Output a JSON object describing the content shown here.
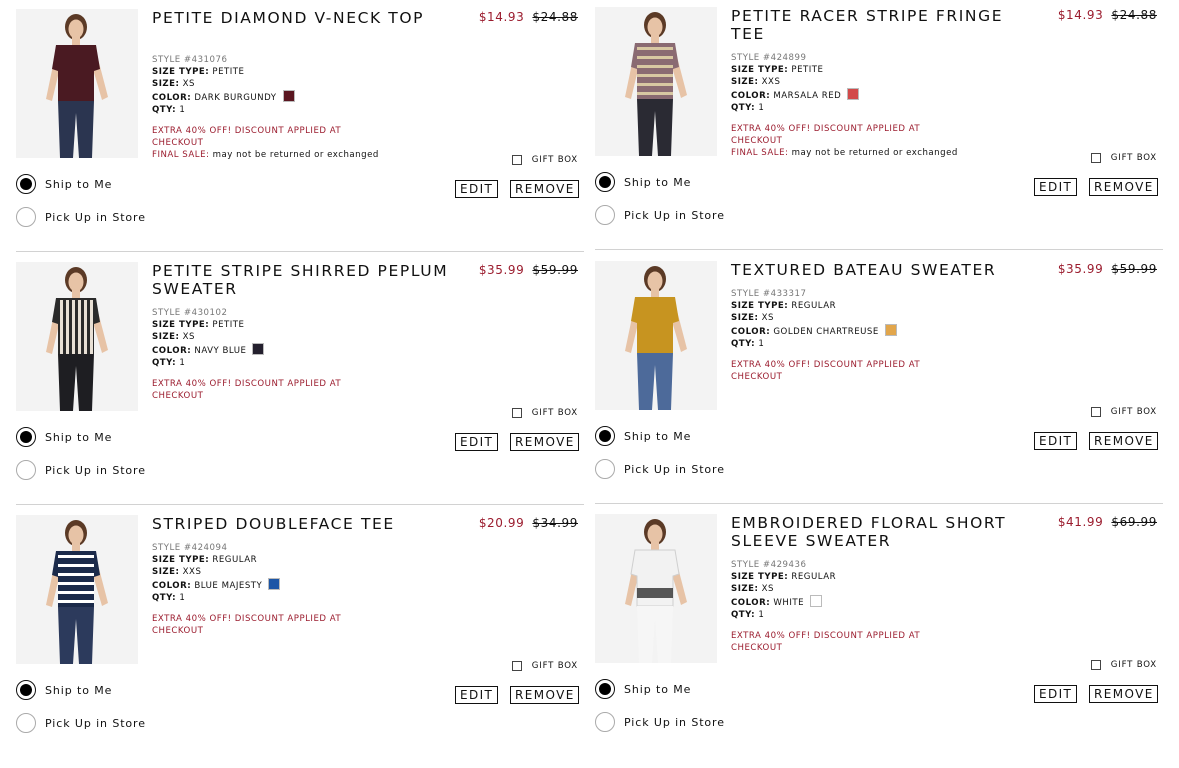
{
  "colors": {
    "sale": "#9b1c2e",
    "text": "#111111",
    "divider": "#d2d2d2"
  },
  "items": [
    {
      "title": "PETITE DIAMOND V-NECK TOP",
      "style": "STYLE #431076",
      "size_type": "PETITE",
      "size": "XS",
      "color": "DARK BURGUNDY",
      "swatch": "#5a1620",
      "qty": "1",
      "sale_price": "$14.93",
      "orig_price": "$24.88",
      "promo": "EXTRA 40% OFF! DISCOUNT APPLIED AT CHECKOUT",
      "final_sale_label": "FINAL SALE:",
      "final_sale_text": "may not be returned or exchanged",
      "gift_box": "GIFT BOX",
      "edit": "EDIT",
      "remove": "REMOVE",
      "ship": "Ship to Me",
      "pickup": "Pick Up in Store",
      "shirt": "#4a1a22",
      "pants": "#2b3550"
    },
    {
      "title": "PETITE RACER STRIPE FRINGE TEE",
      "style": "STYLE #424899",
      "size_type": "PETITE",
      "size": "XXS",
      "color": "MARSALA RED",
      "swatch": "#d24a4a",
      "qty": "1",
      "sale_price": "$14.93",
      "orig_price": "$24.88",
      "promo": "EXTRA 40% OFF! DISCOUNT APPLIED AT CHECKOUT",
      "final_sale_label": "FINAL SALE:",
      "final_sale_text": "may not be returned or exchanged",
      "gift_box": "GIFT BOX",
      "edit": "EDIT",
      "remove": "REMOVE",
      "ship": "Ship to Me",
      "pickup": "Pick Up in Store",
      "shirt": "#8a6a72",
      "pants": "#2a2a33"
    },
    {
      "title": "PETITE STRIPE SHIRRED PEPLUM SWEATER",
      "style": "STYLE #430102",
      "size_type": "PETITE",
      "size": "XS",
      "color": "NAVY BLUE",
      "swatch": "#24202e",
      "qty": "1",
      "sale_price": "$35.99",
      "orig_price": "$59.99",
      "promo": "EXTRA 40% OFF! DISCOUNT APPLIED AT CHECKOUT",
      "final_sale_label": "",
      "final_sale_text": "",
      "gift_box": "GIFT BOX",
      "edit": "EDIT",
      "remove": "REMOVE",
      "ship": "Ship to Me",
      "pickup": "Pick Up in Store",
      "shirt": "#2a2a2a",
      "pants": "#1e1e22"
    },
    {
      "title": "TEXTURED BATEAU SWEATER",
      "style": "STYLE #433317",
      "size_type": "REGULAR",
      "size": "XS",
      "color": "GOLDEN CHARTREUSE",
      "swatch": "#e2a64b",
      "qty": "1",
      "sale_price": "$35.99",
      "orig_price": "$59.99",
      "promo": "EXTRA 40% OFF! DISCOUNT APPLIED AT CHECKOUT",
      "final_sale_label": "",
      "final_sale_text": "",
      "gift_box": "GIFT BOX",
      "edit": "EDIT",
      "remove": "REMOVE",
      "ship": "Ship to Me",
      "pickup": "Pick Up in Store",
      "shirt": "#c79420",
      "pants": "#4d6a9a"
    },
    {
      "title": "STRIPED DOUBLEFACE TEE",
      "style": "STYLE #424094",
      "size_type": "REGULAR",
      "size": "XXS",
      "color": "BLUE MAJESTY",
      "swatch": "#1c55a6",
      "qty": "1",
      "sale_price": "$20.99",
      "orig_price": "$34.99",
      "promo": "EXTRA 40% OFF! DISCOUNT APPLIED AT CHECKOUT",
      "final_sale_label": "",
      "final_sale_text": "",
      "gift_box": "GIFT BOX",
      "edit": "EDIT",
      "remove": "REMOVE",
      "ship": "Ship to Me",
      "pickup": "Pick Up in Store",
      "shirt": "#1b2a4a",
      "pants": "#2c3a5c"
    },
    {
      "title": "EMBROIDERED FLORAL SHORT SLEEVE SWEATER",
      "style": "STYLE #429436",
      "size_type": "REGULAR",
      "size": "XS",
      "color": "WHITE",
      "swatch": "#ffffff",
      "qty": "1",
      "sale_price": "$41.99",
      "orig_price": "$69.99",
      "promo": "EXTRA 40% OFF! DISCOUNT APPLIED AT CHECKOUT",
      "final_sale_label": "",
      "final_sale_text": "",
      "gift_box": "GIFT BOX",
      "edit": "EDIT",
      "remove": "REMOVE",
      "ship": "Ship to Me",
      "pickup": "Pick Up in Store",
      "shirt": "#f2f2f2",
      "pants": "#f6f6f6"
    }
  ],
  "labels": {
    "size_type": "SIZE TYPE:",
    "size": "SIZE:",
    "color": "COLOR:",
    "qty": "QTY:"
  }
}
